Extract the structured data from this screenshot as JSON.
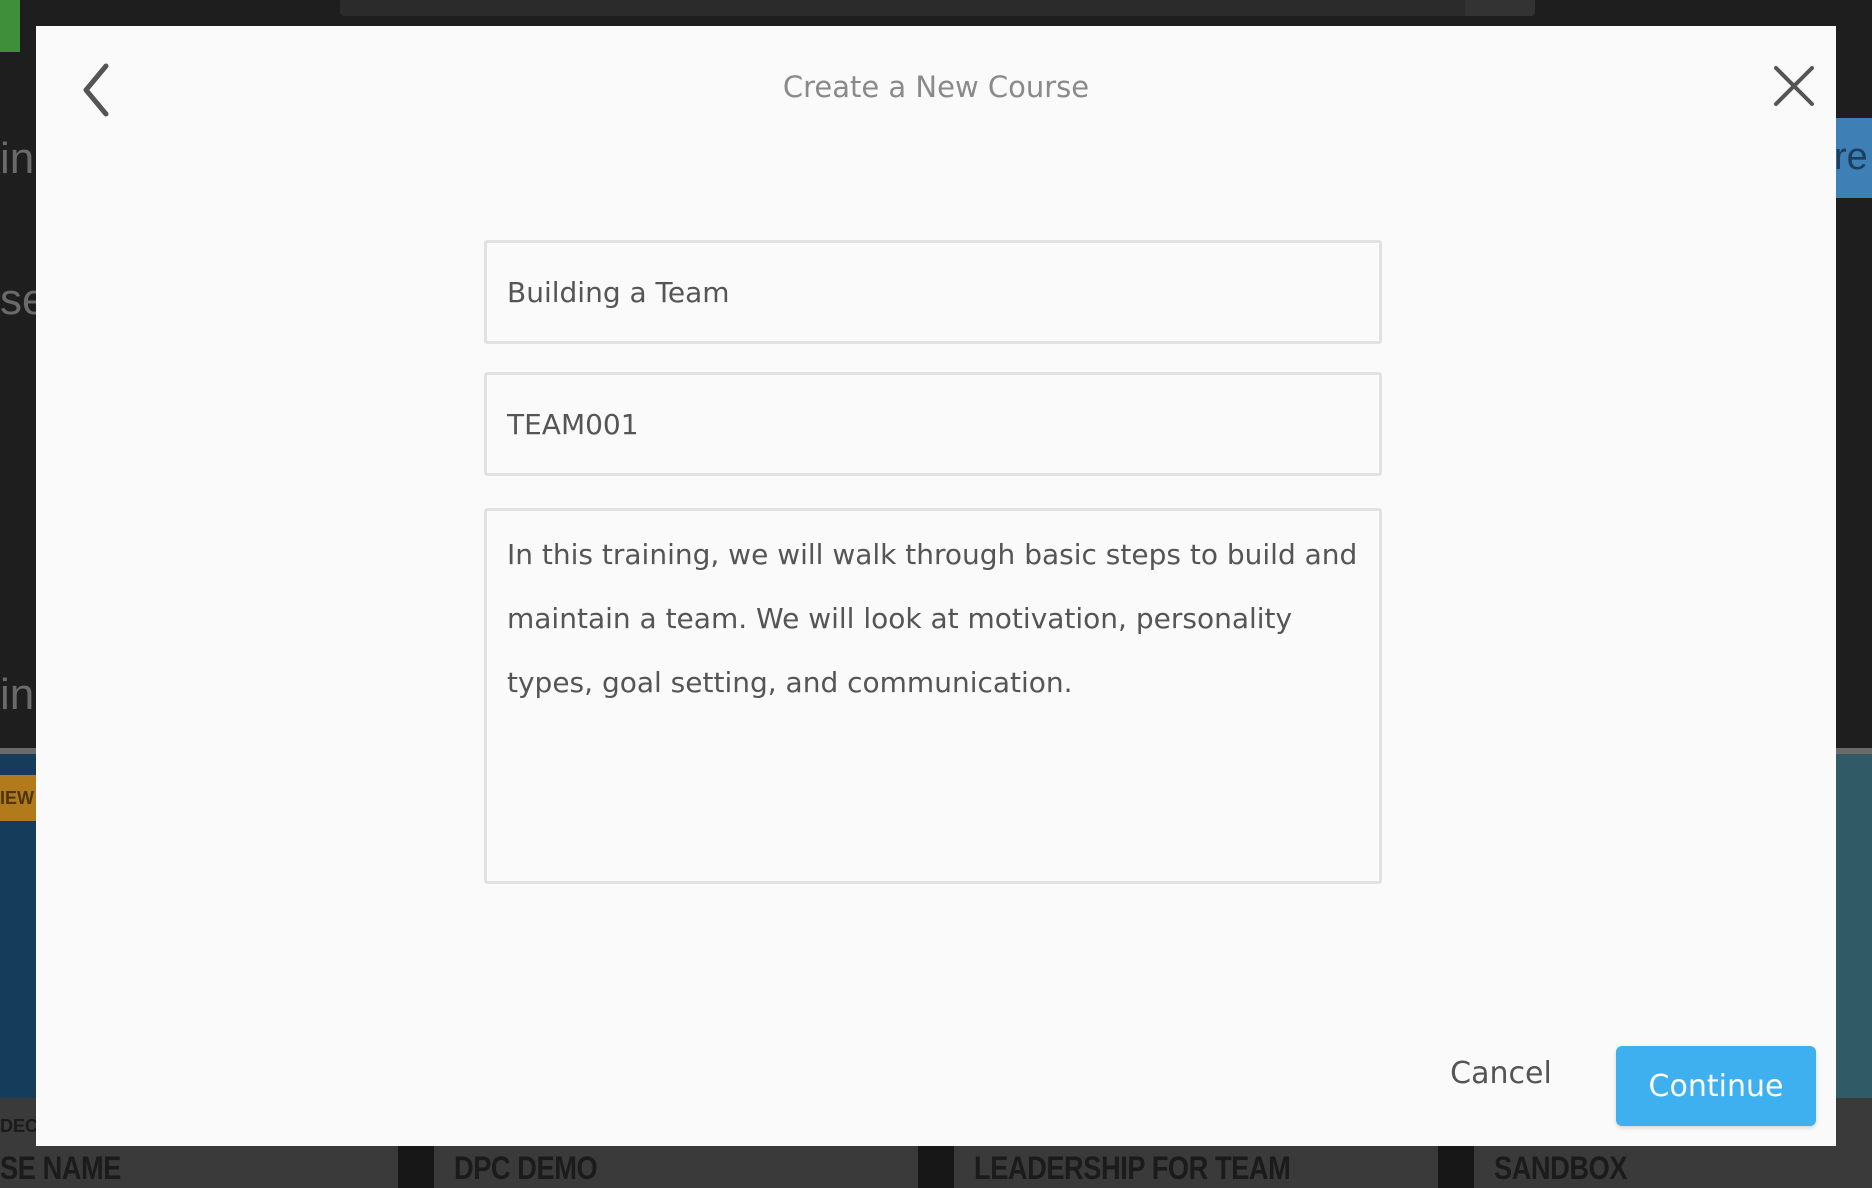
{
  "background": {
    "partial_texts": [
      "ini",
      "se",
      "ini"
    ],
    "right_button_partial": "re",
    "new_badge": "IEW",
    "course_code_partial": "DEC",
    "course_cards": [
      "SE NAME",
      "DPC DEMO",
      "LEADERSHIP FOR TEAM",
      "SANDBOX"
    ]
  },
  "modal": {
    "title": "Create a New Course",
    "back_icon": "chevron-left-icon",
    "close_icon": "close-icon",
    "course_name": {
      "value": "Building a Team"
    },
    "course_code": {
      "value": "TEAM001"
    },
    "description": {
      "value": "In this training, we will walk through basic steps to build and maintain a team. We will look at motivation, personality types, goal setting, and communication."
    },
    "cancel_label": "Cancel",
    "continue_label": "Continue"
  },
  "colors": {
    "accent": "#3eb0ef",
    "modal_bg": "#fafafa",
    "overlay": "#1e1e1e"
  }
}
